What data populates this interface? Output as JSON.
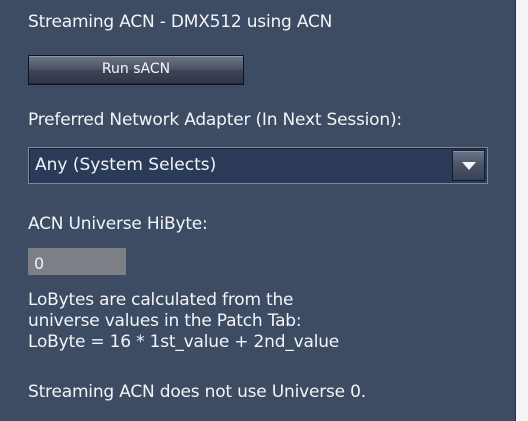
{
  "panel": {
    "heading": "Streaming ACN - DMX512 using ACN",
    "run_button_label": "Run sACN",
    "adapter_label": "Preferred Network Adapter (In Next Session):",
    "adapter_selected": "Any (System Selects)",
    "hibyte_label": "ACN Universe HiByte:",
    "hibyte_value": "0",
    "info_lines": [
      "LoBytes are calculated from the",
      "universe values in the Patch Tab:",
      "LoByte = 16 * 1st_value + 2nd_value"
    ],
    "footnote": "Streaming ACN does not use Universe 0."
  },
  "icons": {
    "dropdown": "chevron-down-icon"
  },
  "colors": {
    "panel_background": "#3d4b63",
    "text": "#f2f4f8",
    "input_background": "#7d7f86",
    "select_background": "#2a3a57"
  }
}
